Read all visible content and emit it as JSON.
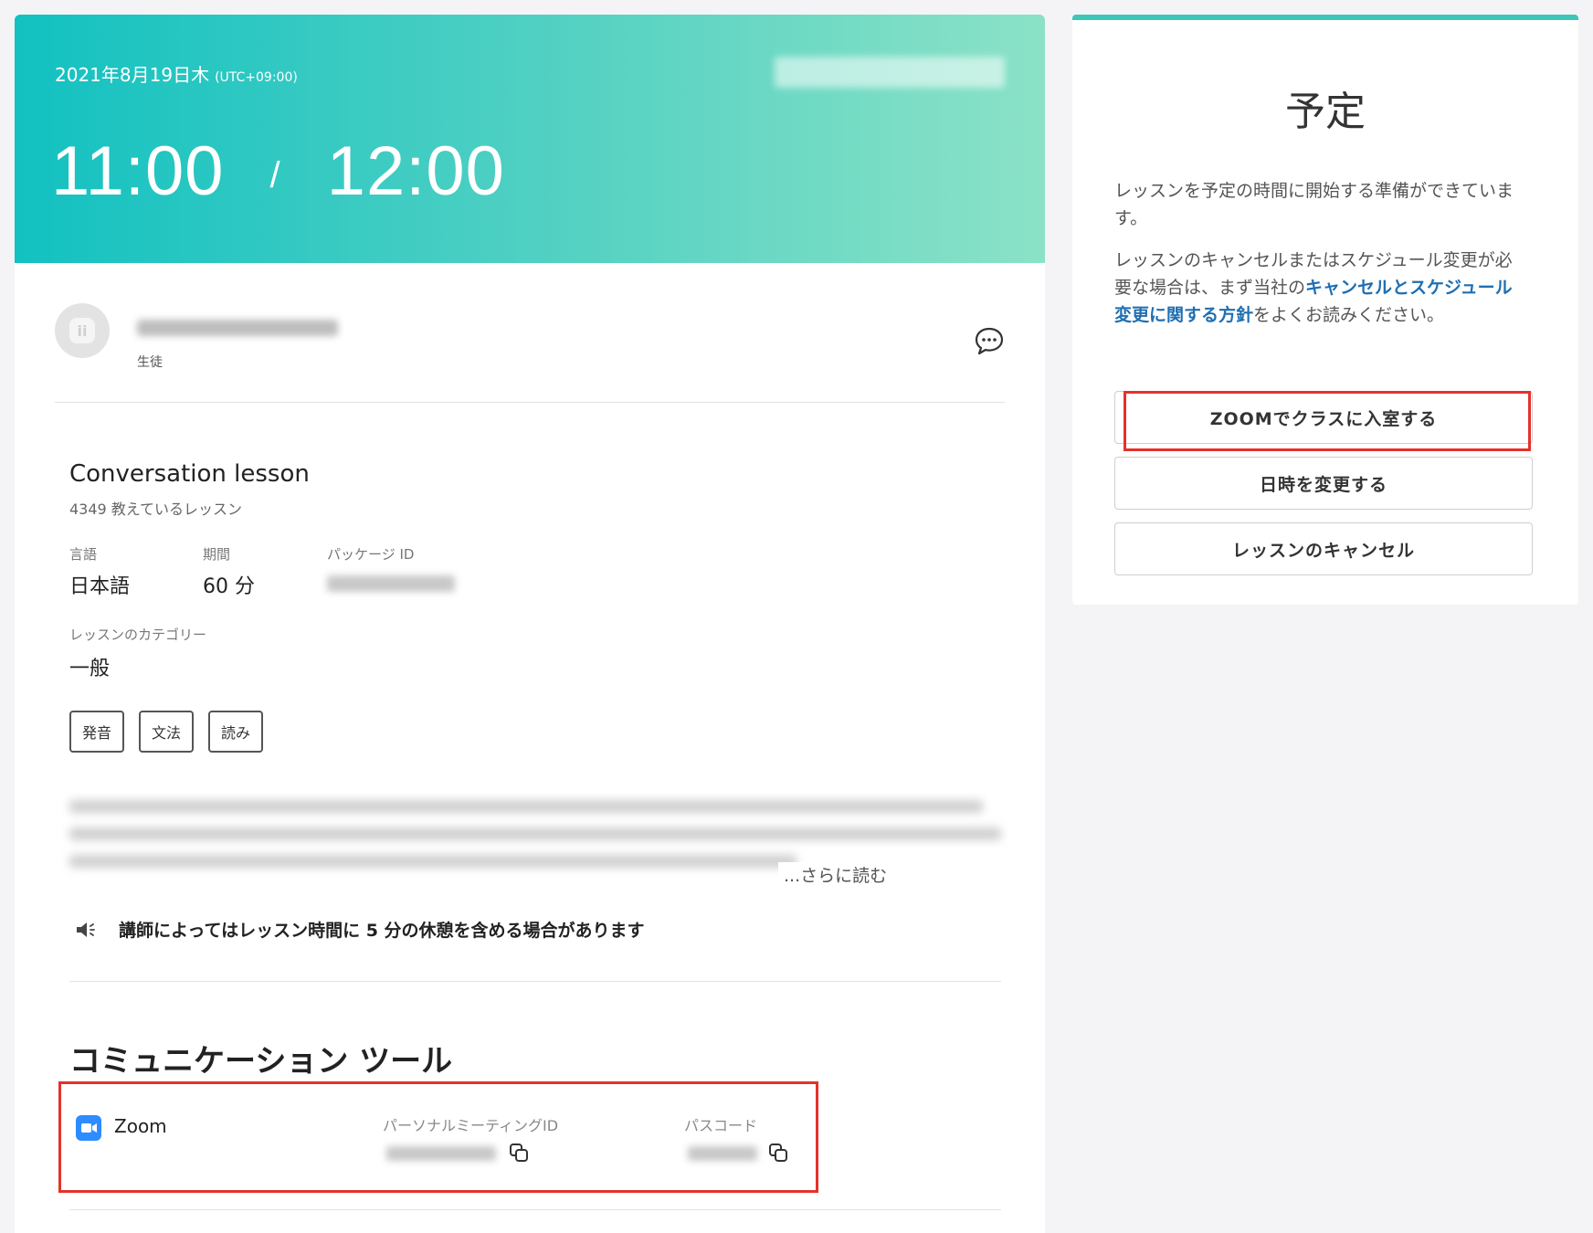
{
  "header": {
    "date": "2021年8月19日木",
    "timezone": "(UTC+09:00)",
    "start_time": "11:00",
    "separator": "/",
    "end_time": "12:00",
    "gradient_colors": [
      "#12c1c1",
      "#8be2c6"
    ]
  },
  "tutor": {
    "role": "生徒",
    "avatar_icon": "ii"
  },
  "lesson": {
    "title": "Conversation lesson",
    "count_text": "4349 教えているレッスン",
    "language_label": "言語",
    "language_value": "日本語",
    "duration_label": "期間",
    "duration_value": "60 分",
    "package_label": "パッケージ ID",
    "category_label": "レッスンのカテゴリー",
    "category_value": "一般",
    "tags": [
      "発音",
      "文法",
      "読み"
    ],
    "read_more": "...さらに読む",
    "notice": "講師によってはレッスン時間に 5 分の休憩を含める場合があります"
  },
  "communication": {
    "title": "コミュニケーション ツール",
    "tool_name": "Zoom",
    "meeting_id_label": "パーソナルミーティングID",
    "passcode_label": "パスコード"
  },
  "schedule": {
    "title": "予定",
    "ready_text": "レッスンを予定の時間に開始する準備ができています。",
    "cancel_text_before": "レッスンのキャンセルまたはスケジュール変更が必要な場合は、まず当社の",
    "policy_link": "キャンセルとスケジュール変更に関する方針",
    "cancel_text_after": "をよくお読みください。",
    "buttons": {
      "zoom": "ZOOMでクラスに入室する",
      "reschedule": "日時を変更する",
      "cancel": "レッスンのキャンセル"
    }
  },
  "colors": {
    "accent": "#3ec6b8",
    "highlight": "#e4322b",
    "link": "#1f6fb2",
    "zoom": "#2d8cff"
  }
}
